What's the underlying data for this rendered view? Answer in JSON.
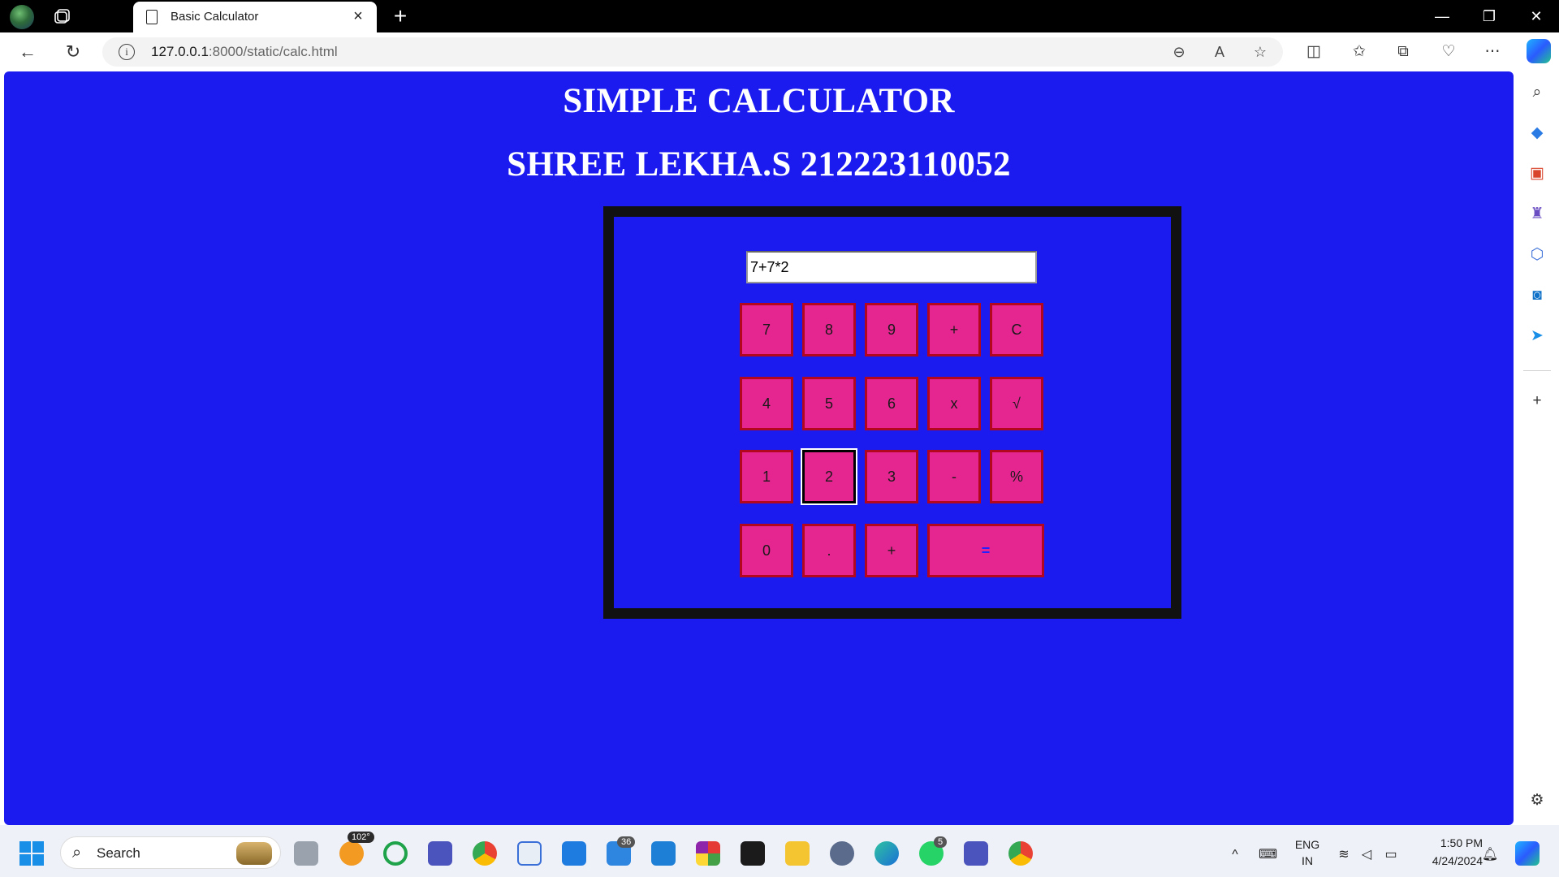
{
  "browser": {
    "tab_title": "Basic Calculator",
    "url_host": "127.0.0.1",
    "url_rest": ":8000/static/calc.html"
  },
  "page": {
    "heading": "SIMPLE CALCULATOR",
    "subheading": "SHREE LEKHA.S 212223110052",
    "display_value": "7+7*2",
    "keys": [
      "7",
      "8",
      "9",
      "+",
      "C",
      "4",
      "5",
      "6",
      "x",
      "√",
      "1",
      "2",
      "3",
      "-",
      "%",
      "0",
      ".",
      "+",
      "="
    ],
    "focused_key": "2"
  },
  "taskbar": {
    "search_label": "Search",
    "weather": "102°",
    "badge_files": "36",
    "badge_whatsapp": "5",
    "language": "ENG",
    "region": "IN",
    "time": "1:50 PM",
    "date": "4/24/2024"
  },
  "colors": {
    "page_background": "#1b1bf0",
    "key_fill": "#e52590",
    "key_border": "#b3071e",
    "calc_frame": "#111111"
  }
}
